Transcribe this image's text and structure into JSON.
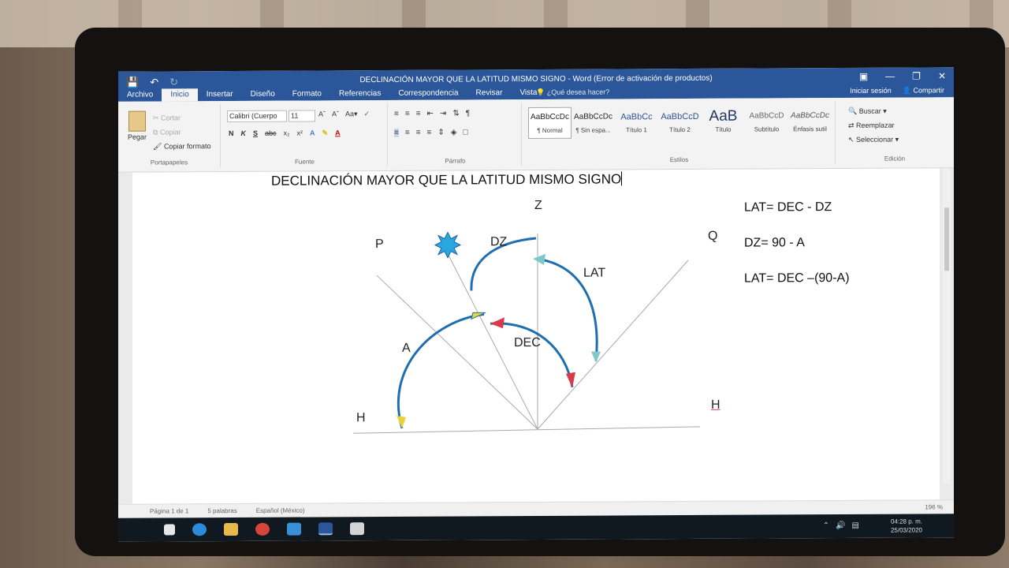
{
  "window": {
    "title": "DECLINACIÓN MAYOR QUE LA LATITUD MISMO SIGNO - Word (Error de activación de productos)",
    "tabs": [
      "Archivo",
      "Inicio",
      "Insertar",
      "Diseño",
      "Formato",
      "Referencias",
      "Correspondencia",
      "Revisar",
      "Vista"
    ],
    "tell_me": "¿Qué desea hacer?",
    "sign_in": "Iniciar sesión",
    "share": "Compartir"
  },
  "ribbon": {
    "clipboard": {
      "paste": "Pegar",
      "cut": "Cortar",
      "copy": "Copiar",
      "format_painter": "Copiar formato",
      "label": "Portapapeles"
    },
    "font": {
      "name": "Calibri (Cuerpo",
      "size": "11",
      "label": "Fuente",
      "buttons": [
        "N",
        "K",
        "S",
        "abc",
        "x₂",
        "x²"
      ]
    },
    "paragraph": {
      "label": "Párrafo"
    },
    "styles": {
      "label": "Estilos",
      "items": [
        {
          "sample": "AaBbCcDc",
          "name": "¶ Normal"
        },
        {
          "sample": "AaBbCcDc",
          "name": "¶ Sin espa..."
        },
        {
          "sample": "AaBbCc",
          "name": "Título 1"
        },
        {
          "sample": "AaBbCcD",
          "name": "Título 2"
        },
        {
          "sample": "AaB",
          "name": "Título"
        },
        {
          "sample": "AaBbCcD",
          "name": "Subtítulo"
        },
        {
          "sample": "AaBbCcDc",
          "name": "Énfasis sutil"
        }
      ]
    },
    "editing": {
      "find": "Buscar",
      "replace": "Reemplazar",
      "select": "Seleccionar",
      "label": "Edición"
    }
  },
  "document": {
    "heading": "DECLINACIÓN MAYOR QUE LA LATITUD MISMO SIGNO",
    "diagram_labels": {
      "z": "Z",
      "p": "P",
      "q": "Q",
      "dz": "DZ",
      "lat": "LAT",
      "a": "A",
      "dec": "DEC",
      "h_left": "H",
      "h_right": "H"
    },
    "formulas": [
      "LAT= DEC - DZ",
      "DZ= 90 - A",
      "LAT= DEC –(90-A)"
    ]
  },
  "status": {
    "page": "Página 1 de 1",
    "words": "5 palabras",
    "language": "Español (México)",
    "zoom": "196 %"
  },
  "taskbar": {
    "time": "04:28 p. m.",
    "date": "25/03/2020"
  },
  "colors": {
    "title_bar": "#2b579a",
    "arc_blue": "#1f6fb0",
    "arc_yellow": "#e8d43a",
    "arc_red": "#d93a4a"
  }
}
